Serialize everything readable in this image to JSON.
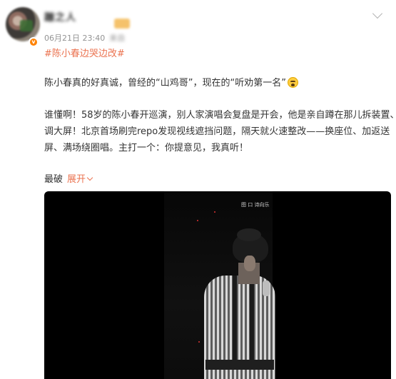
{
  "post": {
    "author": {
      "name": "蹦之人",
      "avatar_icon": "avatar-icon",
      "verified_icon": "verified-badge-icon"
    },
    "timestamp": "06月21日 23:40",
    "source": "来自",
    "topic": "#陈小春边哭边改#",
    "paragraph1": "陈小春真的好真诚，曾经的“山鸡哥”，现在的“听劝第一名”",
    "emoji_icon": "crying-face-emoji",
    "paragraph2_lines": [
      "谁懂啊！58岁的陈小春开巡演，别人家演唱会复盘是开会，他是亲自蹲在那儿拆装置、",
      "调大屏！北京首场刷完repo发现视线遮挡问题，隔天就火速整改——换座位、加返送",
      "屏、满场绕圈唱。主打一个：你提意见，我真听！"
    ]
  },
  "sort": {
    "label": "最破",
    "expand_label": "展开"
  },
  "video": {
    "watermark": "图 口 诗向乐",
    "accent_color": "#eb7350"
  },
  "colors": {
    "accent": "#eb7350",
    "meta": "#939393",
    "text": "#333333"
  }
}
